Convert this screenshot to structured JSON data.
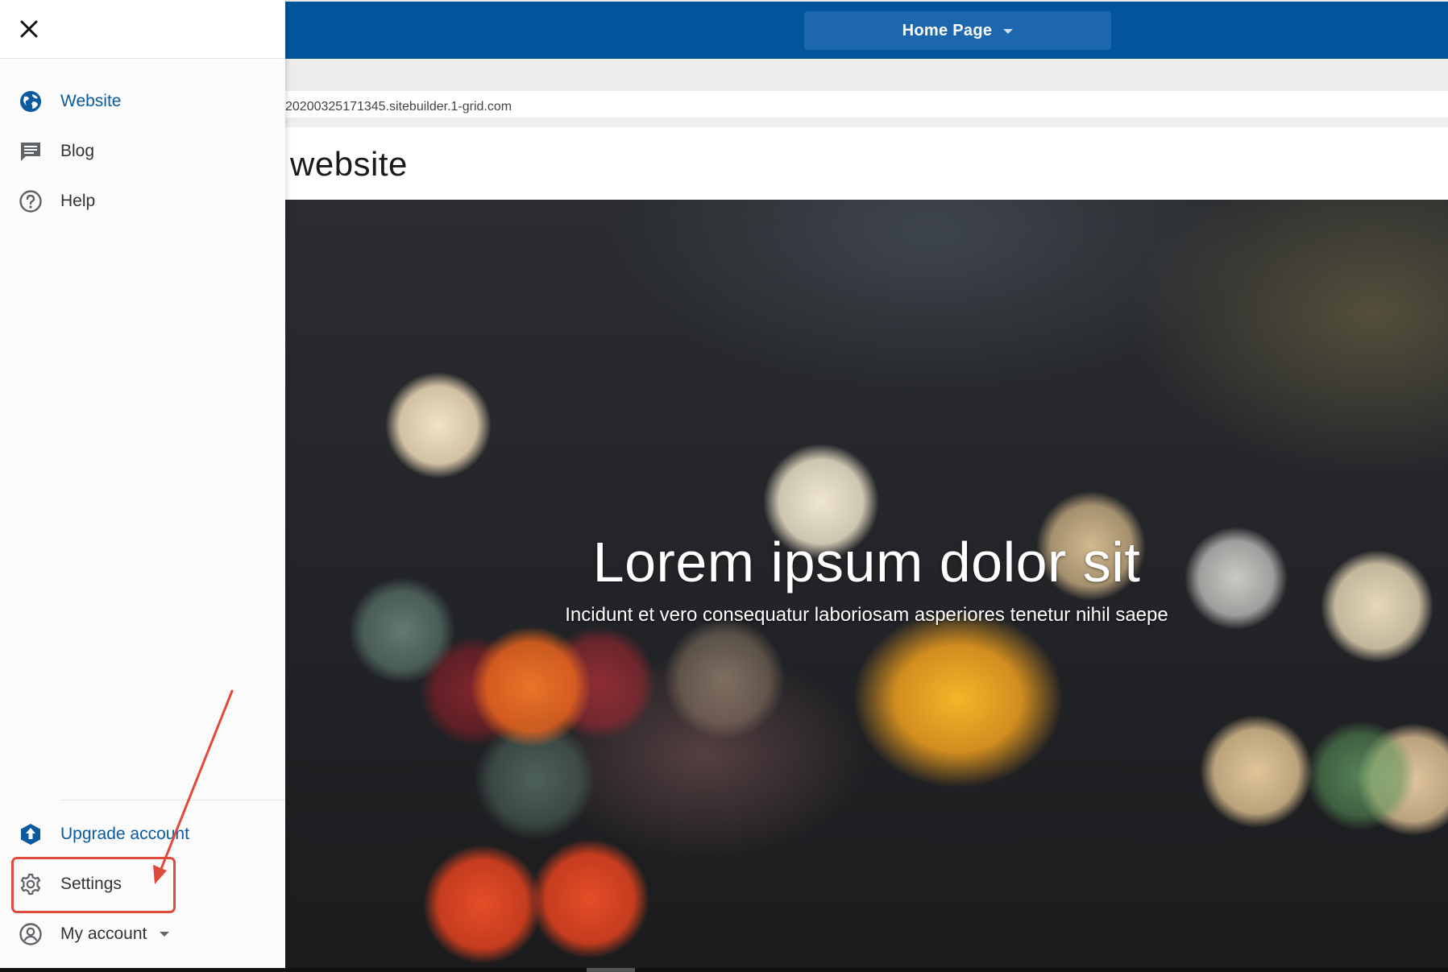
{
  "topbar": {
    "page_selector_label": "Home Page"
  },
  "url_bar": {
    "url": "20200325171345.sitebuilder.1-grid.com"
  },
  "site": {
    "title": "website"
  },
  "hero": {
    "title": "Lorem ipsum dolor sit",
    "subtitle": "Incidunt et vero consequatur laboriosam asperiores tenetur nihil saepe"
  },
  "sidebar": {
    "items": [
      {
        "label": "Website",
        "icon": "globe-icon",
        "active": true
      },
      {
        "label": "Blog",
        "icon": "comment-icon"
      },
      {
        "label": "Help",
        "icon": "help-icon"
      }
    ],
    "bottom_items": [
      {
        "label": "Upgrade account",
        "icon": "upgrade-icon"
      },
      {
        "label": "Settings",
        "icon": "gear-icon"
      },
      {
        "label": "My account",
        "icon": "account-circle-icon"
      }
    ]
  },
  "colors": {
    "brand_blue": "#03559b",
    "selector_blue": "#1c67ad",
    "active_text": "#0a5aa0",
    "annotation_red": "#e04a3a"
  }
}
